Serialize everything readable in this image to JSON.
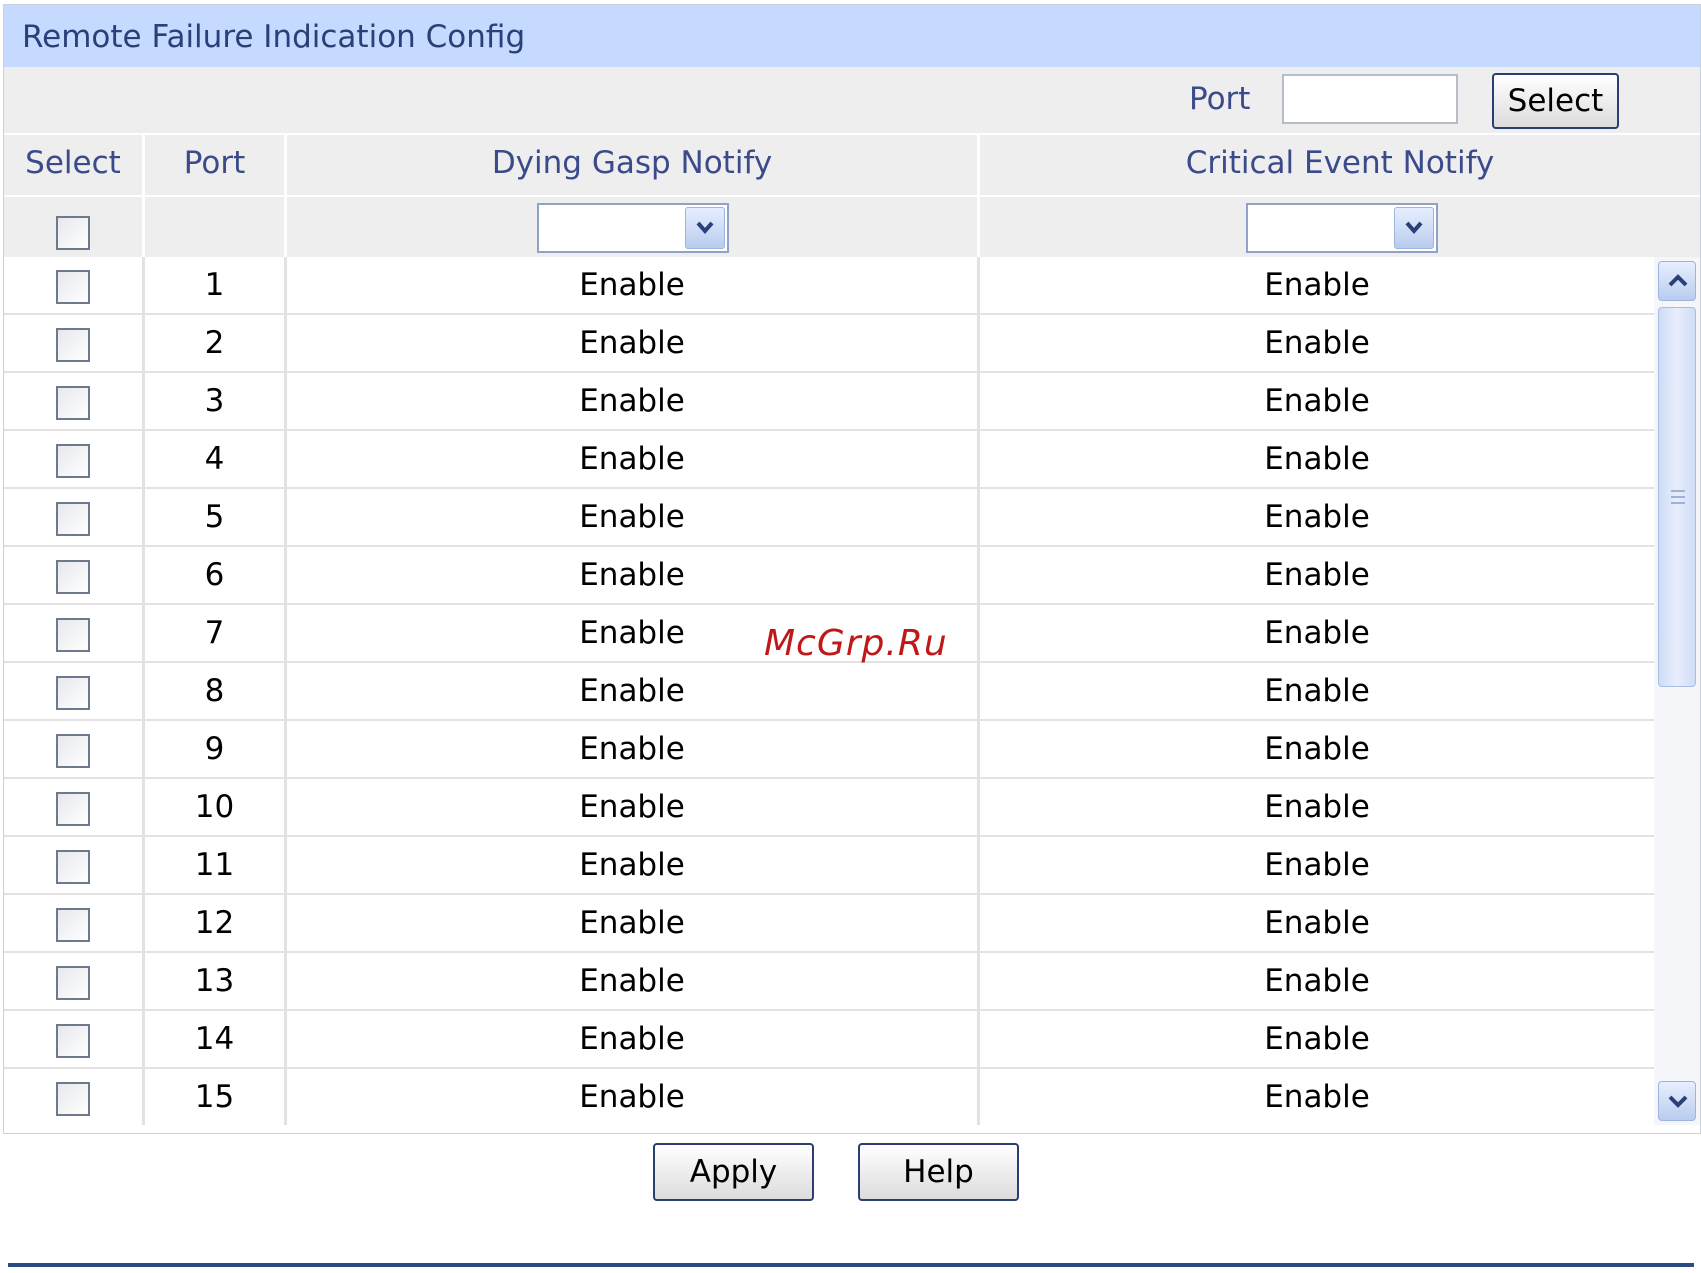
{
  "title": "Remote Failure Indication Config",
  "search": {
    "port_label": "Port",
    "port_value": "",
    "select_button": "Select"
  },
  "columns": {
    "select": "Select",
    "port": "Port",
    "dying_gasp": "Dying Gasp Notify",
    "critical_event": "Critical Event Notify"
  },
  "filter": {
    "select_all_checked": false,
    "dying_gasp_value": "",
    "critical_event_value": ""
  },
  "rows": [
    {
      "port": "1",
      "dying_gasp": "Enable",
      "critical_event": "Enable",
      "selected": false
    },
    {
      "port": "2",
      "dying_gasp": "Enable",
      "critical_event": "Enable",
      "selected": false
    },
    {
      "port": "3",
      "dying_gasp": "Enable",
      "critical_event": "Enable",
      "selected": false
    },
    {
      "port": "4",
      "dying_gasp": "Enable",
      "critical_event": "Enable",
      "selected": false
    },
    {
      "port": "5",
      "dying_gasp": "Enable",
      "critical_event": "Enable",
      "selected": false
    },
    {
      "port": "6",
      "dying_gasp": "Enable",
      "critical_event": "Enable",
      "selected": false
    },
    {
      "port": "7",
      "dying_gasp": "Enable",
      "critical_event": "Enable",
      "selected": false
    },
    {
      "port": "8",
      "dying_gasp": "Enable",
      "critical_event": "Enable",
      "selected": false
    },
    {
      "port": "9",
      "dying_gasp": "Enable",
      "critical_event": "Enable",
      "selected": false
    },
    {
      "port": "10",
      "dying_gasp": "Enable",
      "critical_event": "Enable",
      "selected": false
    },
    {
      "port": "11",
      "dying_gasp": "Enable",
      "critical_event": "Enable",
      "selected": false
    },
    {
      "port": "12",
      "dying_gasp": "Enable",
      "critical_event": "Enable",
      "selected": false
    },
    {
      "port": "13",
      "dying_gasp": "Enable",
      "critical_event": "Enable",
      "selected": false
    },
    {
      "port": "14",
      "dying_gasp": "Enable",
      "critical_event": "Enable",
      "selected": false
    },
    {
      "port": "15",
      "dying_gasp": "Enable",
      "critical_event": "Enable",
      "selected": false
    }
  ],
  "buttons": {
    "apply": "Apply",
    "help": "Help"
  },
  "watermark": "McGrp.Ru",
  "icons": {
    "dropdown": "chevron-down-icon",
    "scroll_up": "chevron-up-icon",
    "scroll_down": "chevron-down-icon"
  },
  "colors": {
    "title_bar": "#c6d9ff",
    "header_text": "#3b4a8a",
    "accent_line": "#2c4b82"
  }
}
